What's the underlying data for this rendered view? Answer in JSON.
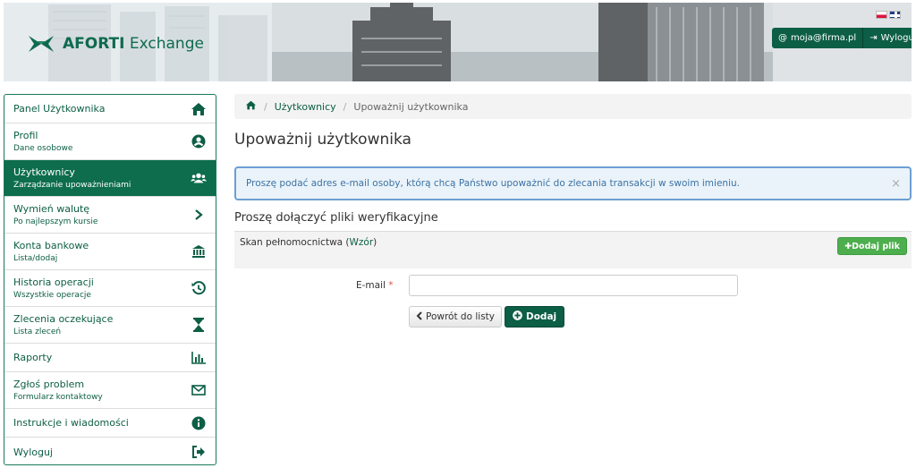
{
  "header": {
    "brand_bold": "AFORTI",
    "brand_rest": " Exchange",
    "email_label": "moja@firma.pl",
    "logout_label": "Wyloguj"
  },
  "sidebar": {
    "items": [
      {
        "title": "Panel Użytkownika",
        "sub": "",
        "icon": "home-icon"
      },
      {
        "title": "Profil",
        "sub": "Dane osobowe",
        "icon": "user-circle-icon"
      },
      {
        "title": "Użytkownicy",
        "sub": "Zarządzanie upoważnieniami",
        "icon": "users-icon"
      },
      {
        "title": "Wymień walutę",
        "sub": "Po najlepszym kursie",
        "icon": "chevron-right-icon"
      },
      {
        "title": "Konta bankowe",
        "sub": "Lista/dodaj",
        "icon": "bank-icon"
      },
      {
        "title": "Historia operacji",
        "sub": "Wszystkie operacje",
        "icon": "history-icon"
      },
      {
        "title": "Zlecenia oczekujące",
        "sub": "Lista zleceń",
        "icon": "hourglass-icon"
      },
      {
        "title": "Raporty",
        "sub": "",
        "icon": "bar-chart-icon"
      },
      {
        "title": "Zgłoś problem",
        "sub": "Formularz kontaktowy",
        "icon": "envelope-icon"
      },
      {
        "title": "Instrukcje i wiadomości",
        "sub": "",
        "icon": "info-icon"
      },
      {
        "title": "Wyloguj",
        "sub": "",
        "icon": "sign-out-icon"
      }
    ],
    "active_index": 2
  },
  "breadcrumb": {
    "link": "Użytkownicy",
    "current": "Upoważnij użytkownika"
  },
  "page_title": "Upoważnij użytkownika",
  "alert": {
    "text": "Proszę podać adres e-mail osoby, którą chcą Państwo upoważnić do zlecania transakcji w swoim imieniu.",
    "close": "×"
  },
  "files": {
    "title": "Proszę dołączyć pliki weryfikacyjne",
    "item_label": "Skan pełnomocnictwa (",
    "item_link": "Wzór",
    "item_close": ")",
    "add_label": "Dodaj plik"
  },
  "form": {
    "email_label": "E-mail",
    "required_mark": "*",
    "email_value": "",
    "back_label": "Powrót do listy",
    "submit_label": "Dodaj"
  },
  "colors": {
    "brand": "#0c5e45",
    "active": "#0d6d4d",
    "alert_border": "#6d9ed3",
    "add_file": "#4cae4c"
  }
}
